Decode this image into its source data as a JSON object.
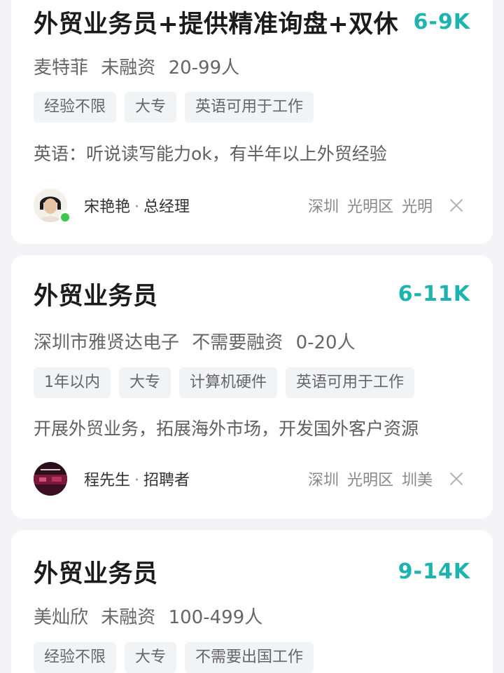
{
  "jobs": [
    {
      "title": "外贸业务员+提供精准询盘+双休",
      "salary": "6-9K",
      "company": "麦特菲",
      "funding": "未融资",
      "size": "20-99人",
      "tags": [
        "经验不限",
        "大专",
        "英语可用于工作"
      ],
      "description": "英语：听说读写能力ok，有半年以上外贸经验",
      "recruiter_name": "宋艳艳",
      "recruiter_role": "总经理",
      "recruiter_online": true,
      "location": [
        "深圳",
        "光明区",
        "光明"
      ]
    },
    {
      "title": "外贸业务员",
      "salary": "6-11K",
      "company": "深圳市雅贤达电子",
      "funding": "不需要融资",
      "size": "0-20人",
      "tags": [
        "1年以内",
        "大专",
        "计算机硬件",
        "英语可用于工作"
      ],
      "description": "开展外贸业务，拓展海外市场，开发国外客户资源",
      "recruiter_name": "程先生",
      "recruiter_role": "招聘者",
      "recruiter_online": false,
      "location": [
        "深圳",
        "光明区",
        "圳美"
      ]
    },
    {
      "title": "外贸业务员",
      "salary": "9-14K",
      "company": "美灿欣",
      "funding": "未融资",
      "size": "100-499人",
      "tags": [
        "经验不限",
        "大专",
        "不需要出国工作"
      ]
    }
  ],
  "separator": "·",
  "colors": {
    "salary": "#1db4b0",
    "background": "#f4f4f6",
    "online": "#3cc84a"
  },
  "icons": {
    "dismiss": "close-icon"
  }
}
